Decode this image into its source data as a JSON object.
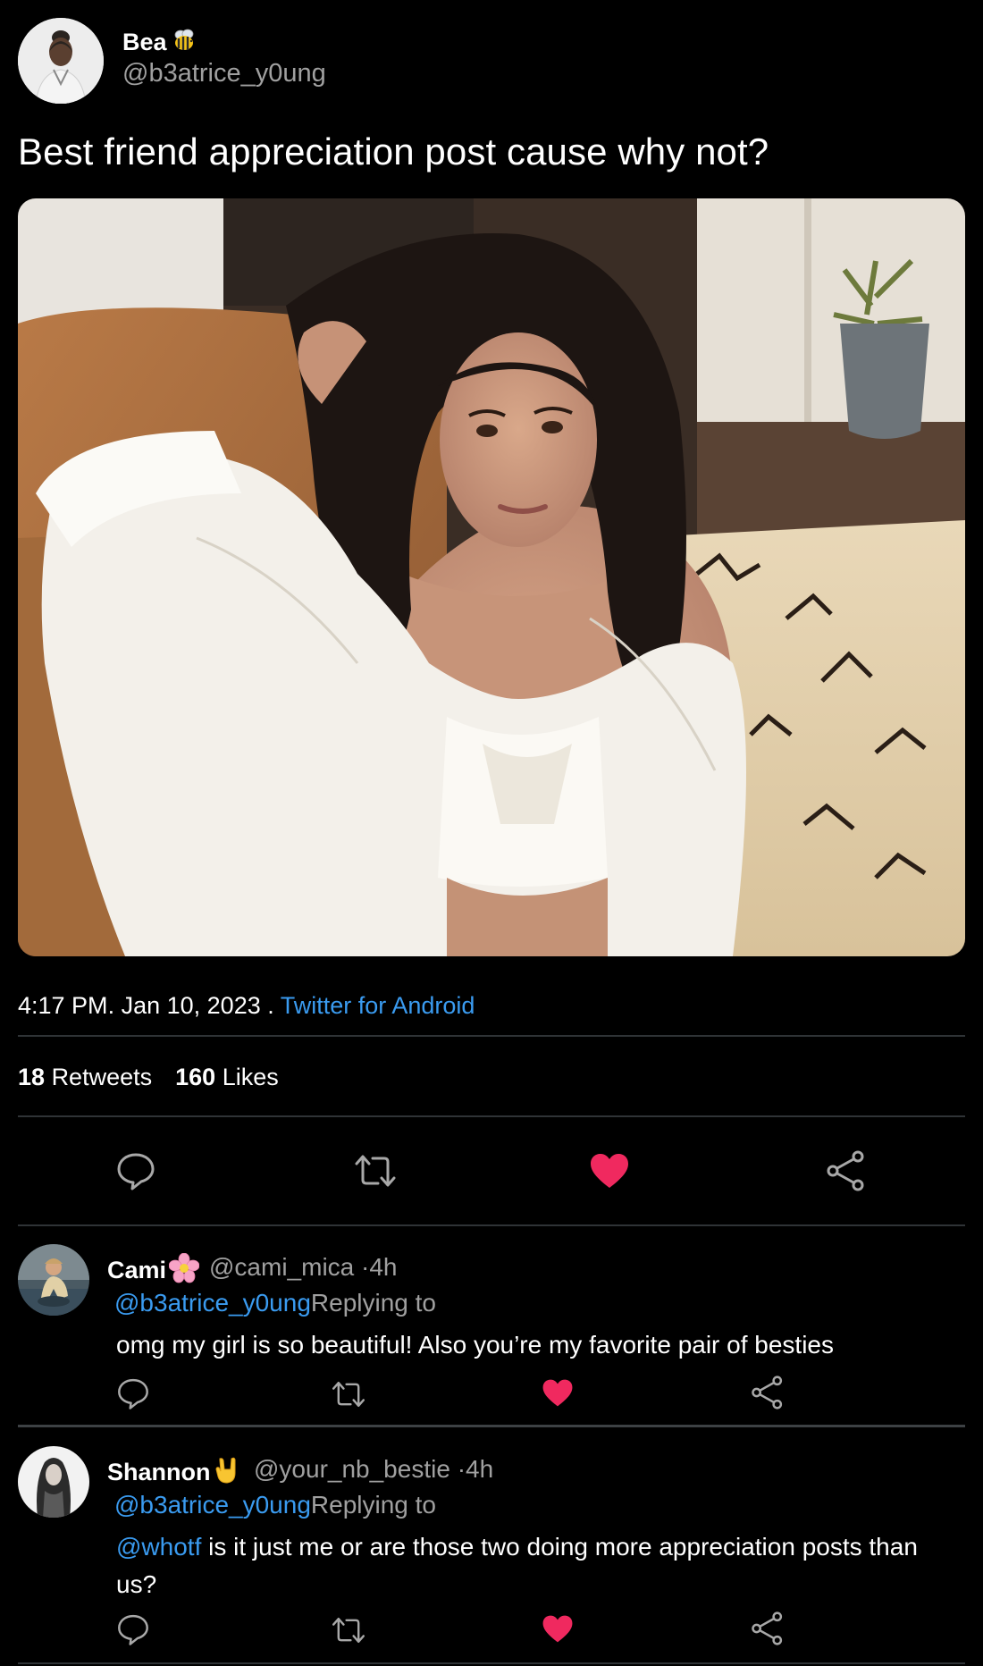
{
  "tweet": {
    "author_name": "Bea",
    "author_emoji": "bee-emoji",
    "author_handle": "@b3atrice_y0ung",
    "text": "Best friend appreciation post cause why not?",
    "time": "4:17 PM",
    "date_sep": ".",
    "date": "Jan 10, 2023",
    "source_sep": ".",
    "source": "Twitter for Android",
    "retweets_count": "18",
    "retweets_label": "Retweets",
    "likes_count": "160",
    "likes_label": "Likes",
    "liked": true
  },
  "colors": {
    "background": "#000000",
    "link": "#3a9bf0",
    "like": "#f0295f",
    "muted": "#a0a0a0",
    "divider": "#2f3336"
  },
  "actions": [
    "reply-icon",
    "retweet-icon",
    "like-icon",
    "share-icon"
  ],
  "replies": [
    {
      "name": "Cami",
      "emoji": "flower-emoji",
      "handle": "@cami_mica",
      "time": "·4h",
      "mention": "@b3atrice_y0ung",
      "replying_label": "Replying to",
      "text": "omg my girl is so beautiful! Also you’re my favorite pair of besties",
      "liked": true
    },
    {
      "name": "Shannon",
      "emoji": "rock-hand-emoji",
      "handle": "@your_nb_bestie",
      "time": "·4h",
      "mention": "@b3atrice_y0ung",
      "replying_label": "Replying to",
      "text_mention": "@whotf",
      "text": " is it just me or are those two doing more appreciation posts than us?",
      "liked": true
    }
  ]
}
